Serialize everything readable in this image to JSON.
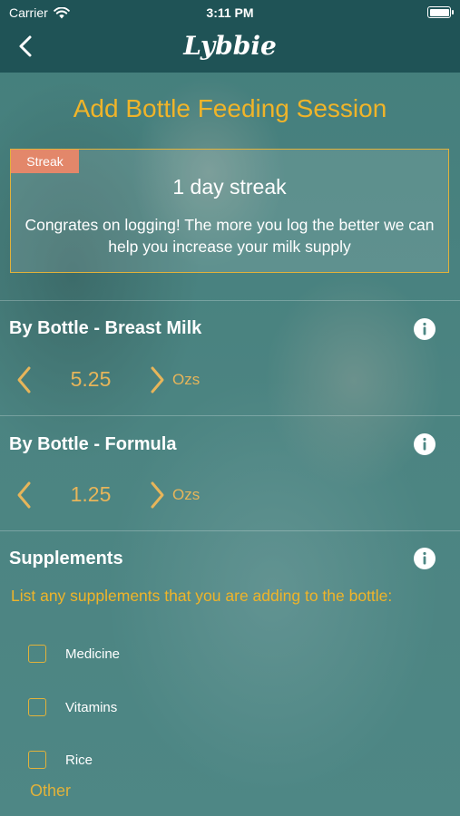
{
  "status_bar": {
    "carrier": "Carrier",
    "time": "3:11 PM"
  },
  "nav": {
    "brand": "Lybbie",
    "back_icon": "chevron-left-icon"
  },
  "page": {
    "title": "Add Bottle Feeding Session"
  },
  "streak": {
    "badge": "Streak",
    "title": "1 day streak",
    "message": "Congrates on logging! The more you log the better we can help you increase your milk supply"
  },
  "breast_milk": {
    "title": "By Bottle - Breast Milk",
    "value": "5.25",
    "unit": "Ozs"
  },
  "formula": {
    "title": "By Bottle - Formula",
    "value": "1.25",
    "unit": "Ozs"
  },
  "supplements": {
    "title": "Supplements",
    "prompt": "List any supplements that you are adding to the bottle:",
    "options": [
      "Medicine",
      "Vitamins",
      "Rice"
    ],
    "other_label": "Other"
  },
  "colors": {
    "accent": "#f0b429",
    "header": "#1f5356",
    "badge": "#e3876a"
  }
}
